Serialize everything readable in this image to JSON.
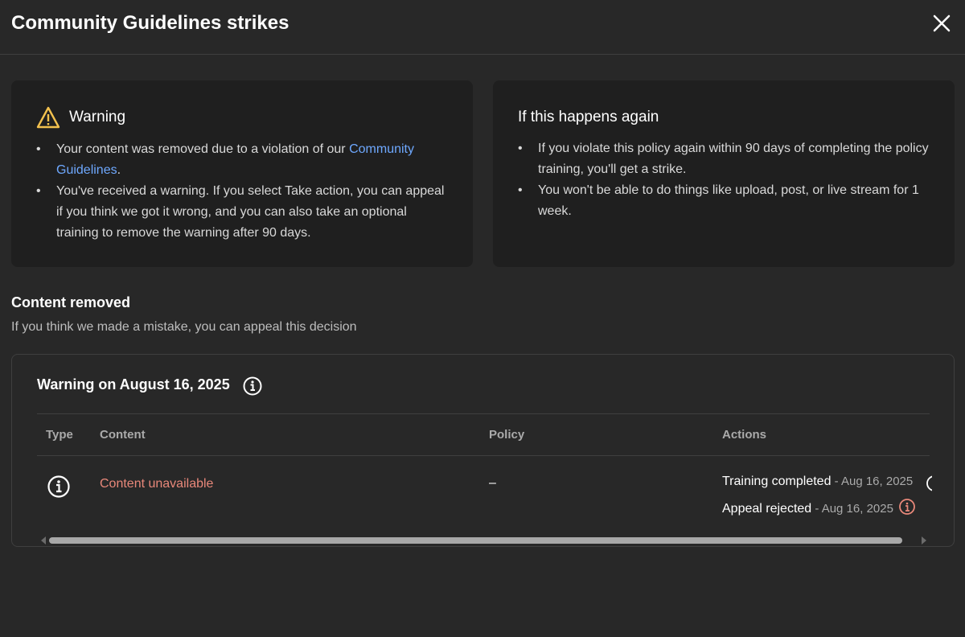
{
  "dialog": {
    "title": "Community Guidelines strikes",
    "close_icon": "close-icon"
  },
  "warning_card": {
    "heading": "Warning",
    "icon": "warning-triangle-icon",
    "icon_color": "#f2c14e",
    "bullet1_text": "Your content was removed due to a violation of our ",
    "bullet1_link": "Community Guidelines",
    "bullet1_end": ".",
    "bullet2": "You've received a warning. If you select Take action, you can appeal if you think we got it wrong, and you can also take an optional training to remove the warning after 90 days."
  },
  "again_card": {
    "heading": "If this happens again",
    "bullets": [
      "If you violate this policy again within 90 days of completing the policy training, you'll get a strike.",
      "You won't be able to do things like upload, post, or live stream for 1 week."
    ]
  },
  "content_removed": {
    "title": "Content removed",
    "subtitle": "If you think we made a mistake, you can appeal this decision"
  },
  "warning_panel": {
    "title": "Warning on August 16, 2025",
    "info_icon": "info-icon",
    "columns": [
      "Type",
      "Content",
      "Policy",
      "Actions"
    ],
    "row": {
      "type_icon": "info-icon",
      "content": "Content unavailable",
      "policy": "–",
      "actions": [
        {
          "label": "Training completed",
          "date": " - Aug 16, 2025",
          "icon": "info-icon"
        },
        {
          "label": "Appeal rejected",
          "date": " - Aug 16, 2025",
          "icon": "info-icon",
          "icon_color": "#e9887a"
        }
      ]
    }
  },
  "colors": {
    "background": "#282828",
    "card": "#1f1f1f",
    "link": "#6ea8fe",
    "error": "#e9887a"
  }
}
